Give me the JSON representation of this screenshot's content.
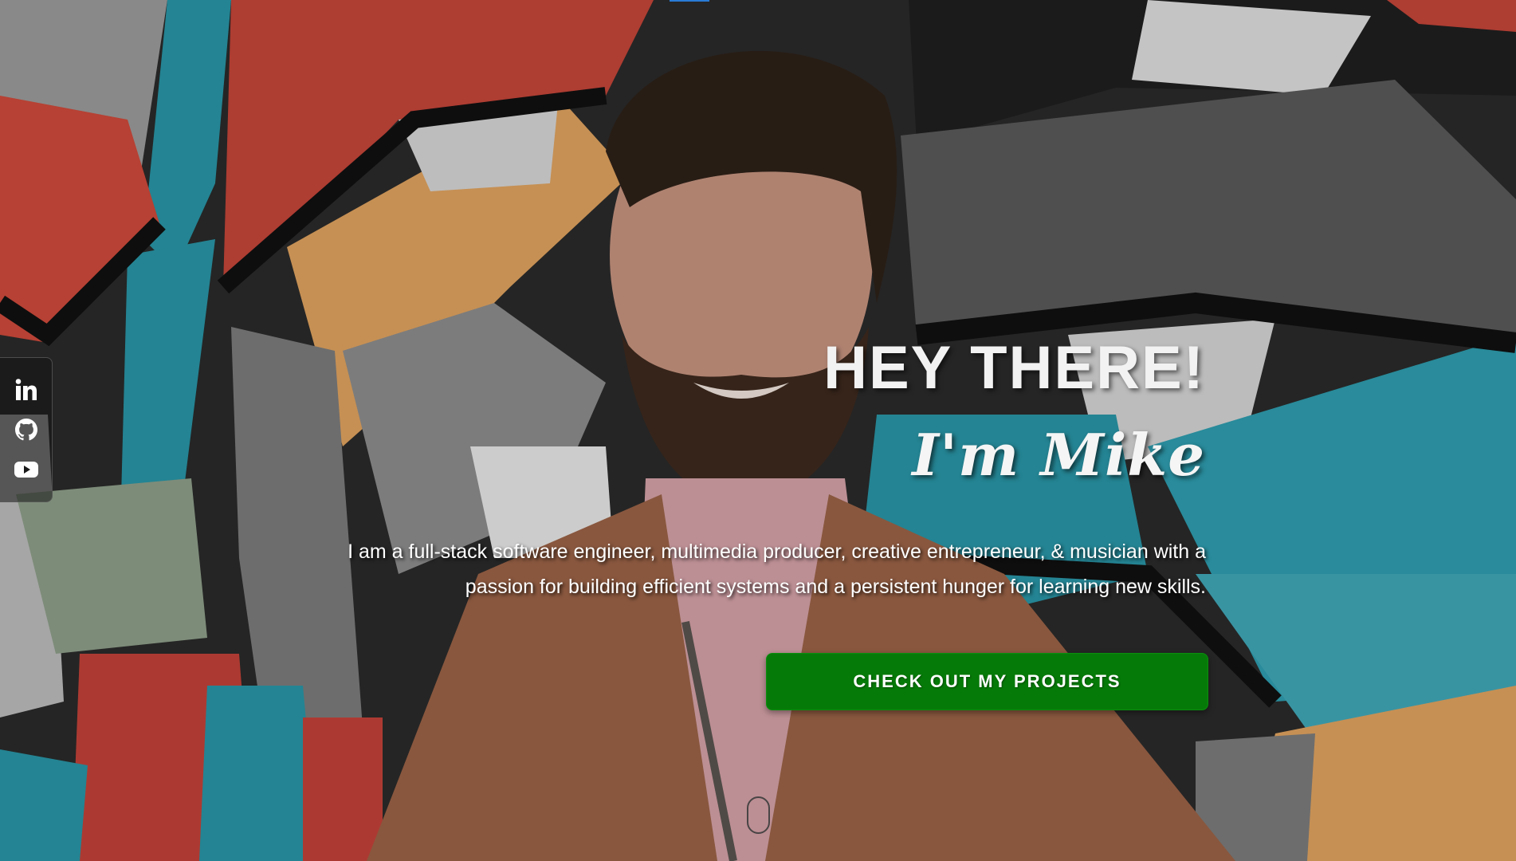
{
  "hero": {
    "headline": "HEY THERE!",
    "name": "I'm Mike",
    "bio": "I am a full-stack software engineer, multimedia producer, creative entrepreneur, & musician with a passion for building efficient systems and a persistent hunger for learning new skills.",
    "cta_label": "CHECK OUT MY PROJECTS"
  },
  "social": {
    "items": [
      {
        "icon": "linkedin-icon"
      },
      {
        "icon": "github-icon"
      },
      {
        "icon": "youtube-icon"
      }
    ]
  },
  "colors": {
    "accent": "#067a08",
    "text": "#ffffff",
    "social_bar_bg": "#141414"
  }
}
